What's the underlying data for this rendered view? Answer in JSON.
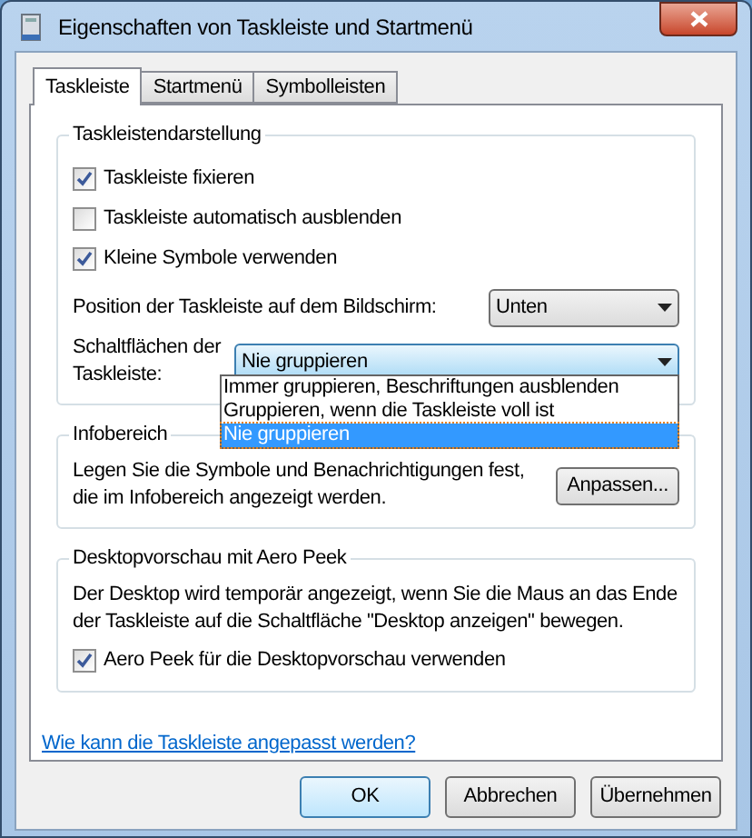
{
  "window": {
    "title": "Eigenschaften von Taskleiste und Startmenü"
  },
  "tabs": [
    {
      "label": "Taskleiste",
      "selected": true
    },
    {
      "label": "Startmenü",
      "selected": false
    },
    {
      "label": "Symbolleisten",
      "selected": false
    }
  ],
  "taskbar_appearance": {
    "title": "Taskleistendarstellung",
    "checkboxes": [
      {
        "label": "Taskleiste fixieren",
        "checked": true
      },
      {
        "label": "Taskleiste automatisch ausblenden",
        "checked": false
      },
      {
        "label": "Kleine Symbole verwenden",
        "checked": true
      }
    ],
    "position": {
      "label": "Position der Taskleiste auf dem Bildschirm:",
      "value": "Unten"
    },
    "buttons_combo": {
      "label": "Schaltflächen der Taskleiste:",
      "value": "Nie gruppieren",
      "expanded": true,
      "options": [
        {
          "label": "Immer gruppieren, Beschriftungen ausblenden",
          "selected": false
        },
        {
          "label": "Gruppieren, wenn die Taskleiste voll ist",
          "selected": false
        },
        {
          "label": "Nie gruppieren",
          "selected": true
        }
      ]
    }
  },
  "notification_area": {
    "title": "Infobereich",
    "text": "Legen Sie die Symbole und Benachrichtigungen fest, die im Infobereich angezeigt werden.",
    "button": "Anpassen..."
  },
  "aero_peek": {
    "title": "Desktopvorschau mit Aero Peek",
    "text": "Der Desktop wird temporär angezeigt, wenn Sie die Maus an das Ende der Taskleiste auf die Schaltfläche \"Desktop anzeigen\" bewegen.",
    "checkbox": {
      "label": "Aero Peek für die Desktopvorschau verwenden",
      "checked": true
    }
  },
  "help_link": "Wie kann die Taskleiste angepasst werden?",
  "buttons": [
    {
      "label": "OK",
      "kind": "default"
    },
    {
      "label": "Abbrechen",
      "kind": "normal"
    },
    {
      "label": "Übernehmen",
      "kind": "normal"
    }
  ]
}
